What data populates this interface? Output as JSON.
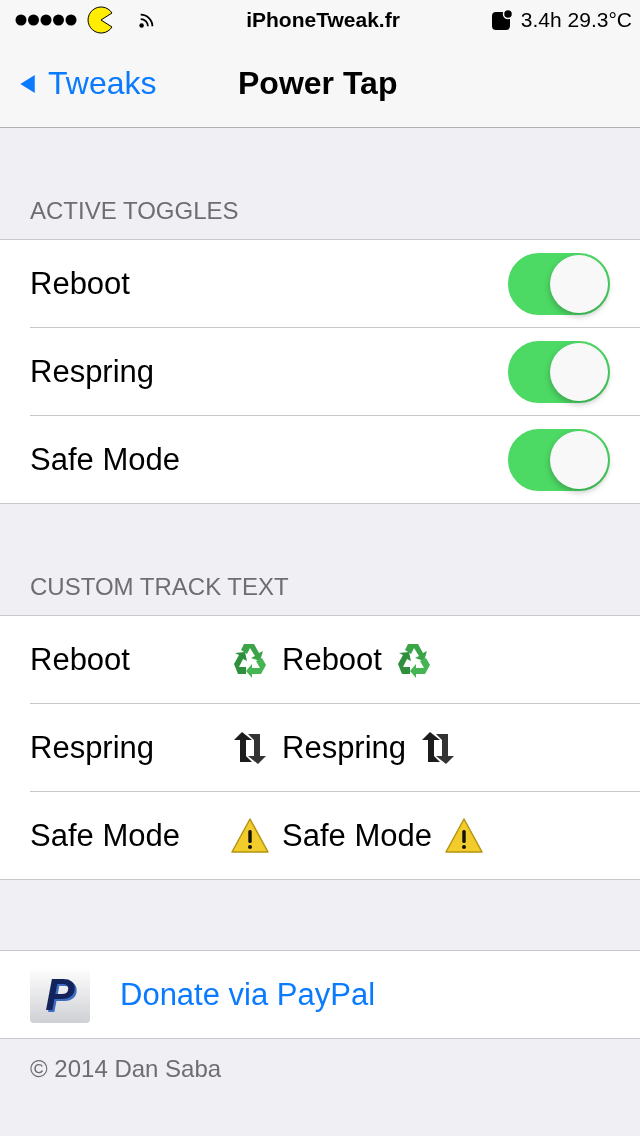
{
  "status_bar": {
    "carrier": "iPhoneTweak.fr",
    "battery_text": "3.4h 29.3°C"
  },
  "nav": {
    "back": "Tweaks",
    "title": "Power Tap"
  },
  "sections": [
    {
      "header": "ACTIVE TOGGLES",
      "rows": [
        {
          "kind": "switch",
          "label": "Reboot",
          "on": true
        },
        {
          "kind": "switch",
          "label": "Respring",
          "on": true
        },
        {
          "kind": "switch",
          "label": "Safe Mode",
          "on": true
        }
      ]
    },
    {
      "header": "CUSTOM TRACK TEXT",
      "rows": [
        {
          "kind": "text",
          "label": "Reboot",
          "value": "Reboot"
        },
        {
          "kind": "text",
          "label": "Respring",
          "value": "Respring"
        },
        {
          "kind": "text",
          "label": "Safe Mode",
          "value": "Safe Mode"
        }
      ]
    }
  ],
  "donate": {
    "logo": "P",
    "label": "Donate via PayPal"
  },
  "footer": "© 2014 Dan Saba"
}
